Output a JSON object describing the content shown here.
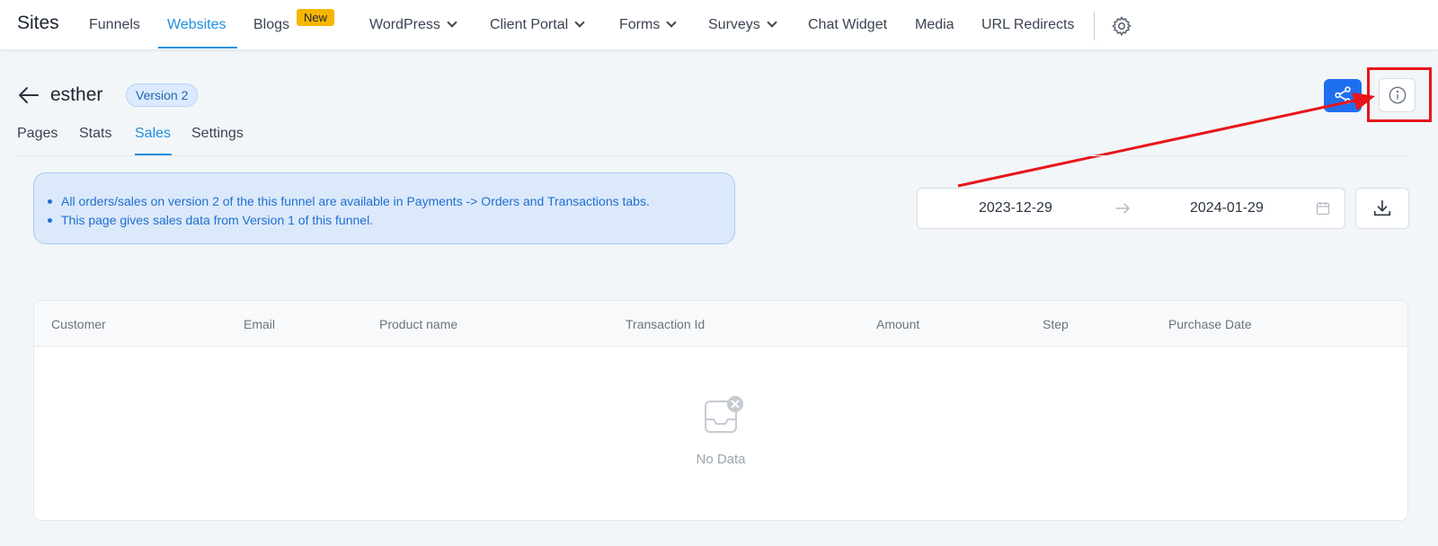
{
  "nav": {
    "brand": "Sites",
    "items": [
      {
        "label": "Funnels"
      },
      {
        "label": "Websites"
      },
      {
        "label": "Blogs"
      },
      {
        "label": "WordPress"
      },
      {
        "label": "Client Portal"
      },
      {
        "label": "Forms"
      },
      {
        "label": "Surveys"
      },
      {
        "label": "Chat Widget"
      },
      {
        "label": "Media"
      },
      {
        "label": "URL Redirects"
      }
    ],
    "new_badge": "New"
  },
  "header": {
    "title": "esther",
    "version": "Version 2"
  },
  "tabs": [
    {
      "label": "Pages"
    },
    {
      "label": "Stats"
    },
    {
      "label": "Sales"
    },
    {
      "label": "Settings"
    }
  ],
  "note": {
    "lines": [
      "All orders/sales on version 2 of the this funnel are available in Payments -> Orders and Transactions tabs.",
      "This page gives sales data from Version 1 of this funnel."
    ]
  },
  "date_range": {
    "start": "2023-12-29",
    "end": "2024-01-29"
  },
  "table": {
    "columns": [
      "Customer",
      "Email",
      "Product name",
      "Transaction Id",
      "Amount",
      "Step",
      "Purchase Date"
    ],
    "rows": [],
    "empty_text": "No Data"
  },
  "colors": {
    "accent": "#1e8ee0",
    "primary_button": "#1e6ff0",
    "annotation": "#e8161b",
    "badge": "#f7b500"
  }
}
